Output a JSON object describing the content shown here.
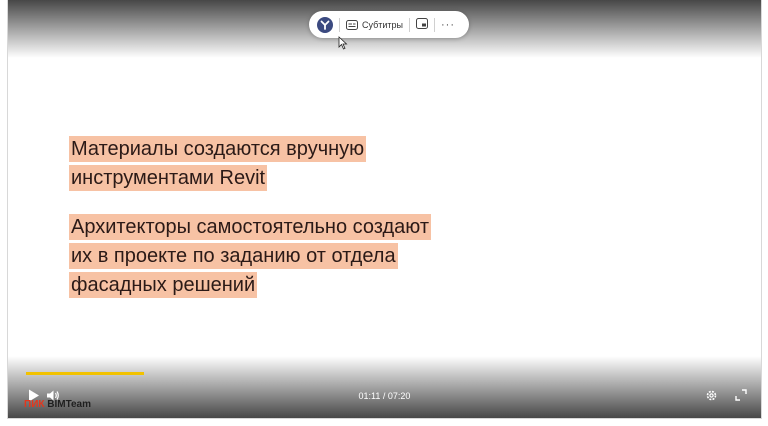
{
  "pill": {
    "subtitles_label": "Субтитры",
    "more_label": "···"
  },
  "slide": {
    "paragraphs": [
      [
        "Материалы создаются вручную",
        "инструментами Revit"
      ],
      [
        "Архитекторы самостоятельно создают",
        "их в проекте по заданию от отдела",
        "фасадных решений"
      ]
    ]
  },
  "player": {
    "time": "01:11 / 07:20",
    "progress": 0.161
  },
  "brand": {
    "pik": "ПИК",
    "bim": "BIMTeam"
  },
  "colors": {
    "highlight": "#f7c2a4",
    "progress": "#f2c200",
    "brand_red": "#e3361c"
  },
  "icons": [
    "yandex-logo-icon",
    "subtitles-icon",
    "pip-icon",
    "more-icon",
    "play-icon",
    "volume-icon",
    "settings-icon",
    "fullscreen-icon",
    "cursor-icon"
  ]
}
